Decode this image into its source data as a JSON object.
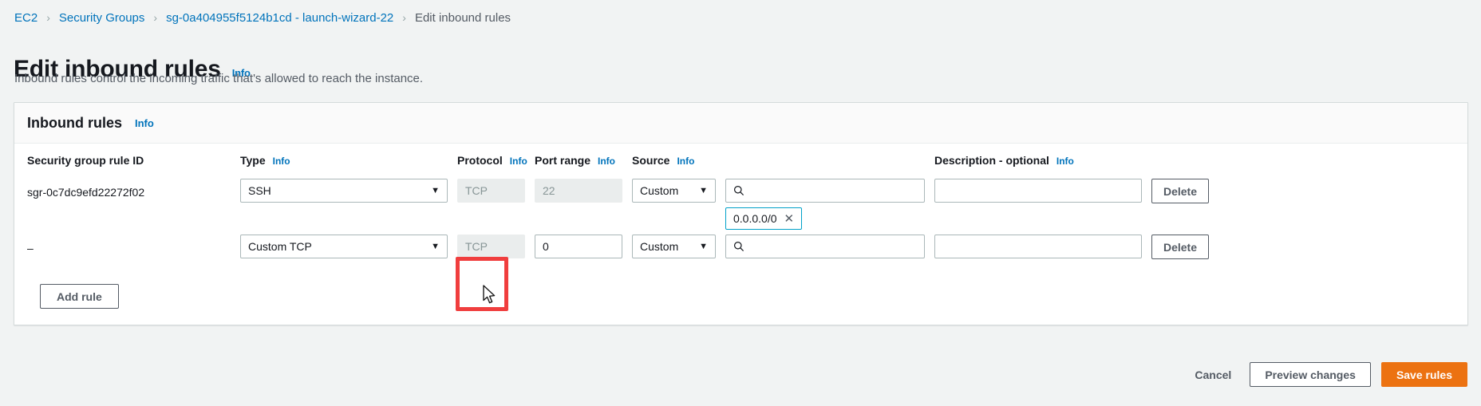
{
  "breadcrumb": [
    {
      "label": "EC2",
      "type": "link"
    },
    {
      "label": "Security Groups",
      "type": "link"
    },
    {
      "label": "sg-0a404955f5124b1cd - launch-wizard-22",
      "type": "link"
    },
    {
      "label": "Edit inbound rules",
      "type": "current"
    }
  ],
  "breadcrumb_separator": "›",
  "page": {
    "title": "Edit inbound rules",
    "title_info": "Info",
    "description": "Inbound rules control the incoming traffic that's allowed to reach the instance."
  },
  "panel": {
    "title": "Inbound rules",
    "title_info": "Info",
    "columns": [
      {
        "label": "Security group rule ID",
        "info": ""
      },
      {
        "label": "Type",
        "info": "Info"
      },
      {
        "label": "Protocol",
        "info": "Info"
      },
      {
        "label": "Port range",
        "info": "Info"
      },
      {
        "label": "Source",
        "info": "Info"
      },
      {
        "label": "",
        "info": ""
      },
      {
        "label": "Description - optional",
        "info": "Info"
      },
      {
        "label": "",
        "info": ""
      }
    ],
    "rows": [
      {
        "rule_id": "sgr-0c7dc9efd22272f02",
        "type": "SSH",
        "protocol": "TCP",
        "protocol_disabled": true,
        "port_range": "22",
        "port_disabled": true,
        "source_type": "Custom",
        "source_search": "",
        "source_token": "0.0.0.0/0",
        "source_token_remove": "✕",
        "description": "",
        "delete_label": "Delete"
      },
      {
        "rule_id": "–",
        "type": "Custom TCP",
        "protocol": "TCP",
        "protocol_disabled": true,
        "port_range": "0",
        "port_disabled": false,
        "source_type": "Custom",
        "source_search": "",
        "source_token": "",
        "source_token_remove": "",
        "description": "",
        "delete_label": "Delete"
      }
    ],
    "add_rule_label": "Add rule"
  },
  "footer": {
    "cancel_label": "Cancel",
    "preview_label": "Preview changes",
    "save_label": "Save rules"
  },
  "icons": {
    "caret_down": "▼",
    "search": "search-icon",
    "cursor": "mouse-pointer-icon"
  },
  "colors": {
    "link": "#0073bb",
    "primary": "#ec7211",
    "page_bg": "#f1f3f3",
    "panel_bg": "#ffffff",
    "token_border": "#00a1c9",
    "highlight": "#f03e3e"
  }
}
